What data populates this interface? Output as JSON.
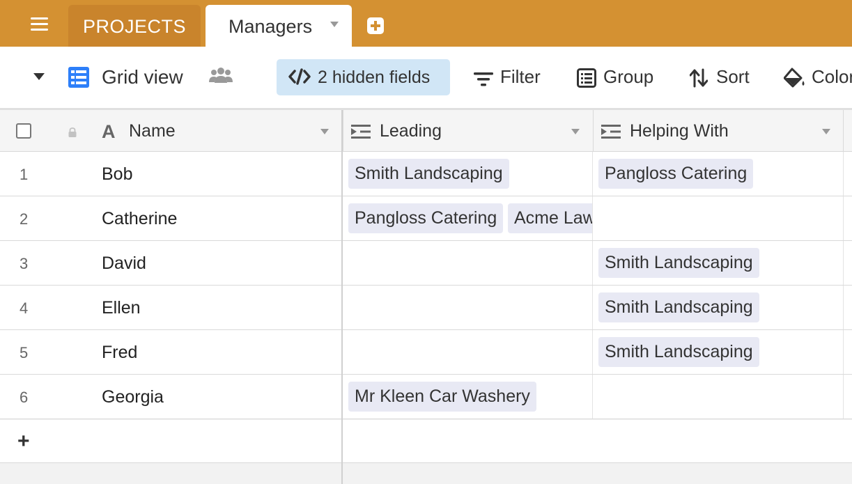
{
  "tabs": {
    "projects": "PROJECTS",
    "managers": "Managers"
  },
  "toolbar": {
    "view_name": "Grid view",
    "hidden_fields": "2 hidden fields",
    "filter": "Filter",
    "group": "Group",
    "sort": "Sort",
    "color": "Color"
  },
  "columns": {
    "name": "Name",
    "leading": "Leading",
    "helping": "Helping With"
  },
  "rows": [
    {
      "num": "1",
      "name": "Bob",
      "leading": [
        "Smith Landscaping"
      ],
      "helping": [
        "Pangloss Catering"
      ]
    },
    {
      "num": "2",
      "name": "Catherine",
      "leading": [
        "Pangloss Catering",
        "Acme Law"
      ],
      "helping": []
    },
    {
      "num": "3",
      "name": "David",
      "leading": [],
      "helping": [
        "Smith Landscaping"
      ]
    },
    {
      "num": "4",
      "name": "Ellen",
      "leading": [],
      "helping": [
        "Smith Landscaping"
      ]
    },
    {
      "num": "5",
      "name": "Fred",
      "leading": [],
      "helping": [
        "Smith Landscaping"
      ]
    },
    {
      "num": "6",
      "name": "Georgia",
      "leading": [
        "Mr Kleen Car Washery"
      ],
      "helping": []
    }
  ],
  "add_row_label": "+",
  "icons": {
    "menu": "hamburger-icon",
    "add_table": "plus-square-icon",
    "grid": "grid-icon",
    "collaborators": "people-icon",
    "hidden_fields": "code-icon",
    "filter": "filter-icon",
    "group": "group-icon",
    "sort": "sort-icon",
    "color": "paint-bucket-icon"
  },
  "colors": {
    "topbar": "#d49132",
    "hidden_fields_bg": "#d1e6f6",
    "chip_bg": "#e8e9f4",
    "grid_icon": "#2d7ff9"
  }
}
